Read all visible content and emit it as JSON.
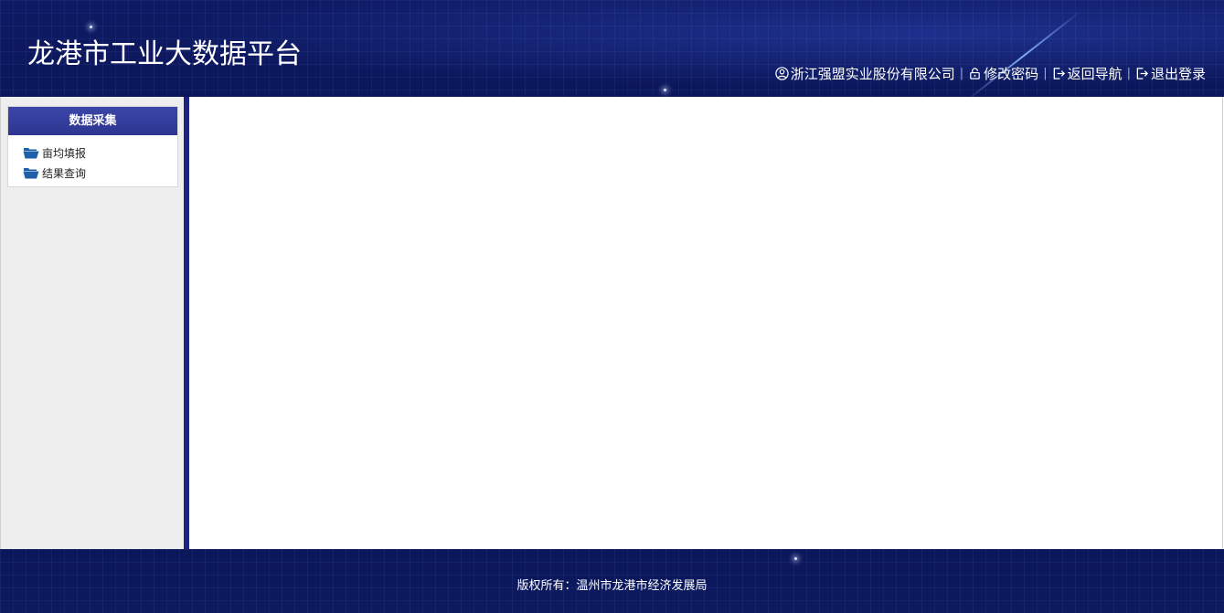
{
  "header": {
    "title": "龙港市工业大数据平台",
    "nav": {
      "company": "浙江强盟实业股份有限公司",
      "change_password": "修改密码",
      "back_nav": "返回导航",
      "logout": "退出登录",
      "separator": "|"
    }
  },
  "sidebar": {
    "section_title": "数据采集",
    "items": [
      {
        "label": "亩均填报",
        "icon": "folder-open-icon"
      },
      {
        "label": "结果查询",
        "icon": "folder-open-icon"
      }
    ]
  },
  "footer": {
    "copyright": "版权所有：温州市龙港市经济发展局"
  },
  "colors": {
    "header_bg": "#0e1a63",
    "sidebar_divider": "#1e2281",
    "menu_header": "#3a46a8",
    "folder_icon": "#1f5fa8"
  }
}
